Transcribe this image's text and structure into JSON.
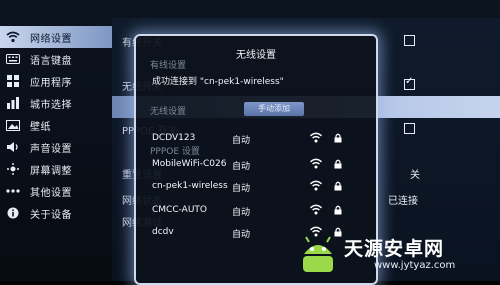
{
  "nav": {
    "items": [
      {
        "label": "网络设置",
        "icon": "wifi-icon",
        "selected": true
      },
      {
        "label": "语言键盘",
        "icon": "keyboard-icon",
        "selected": false
      },
      {
        "label": "应用程序",
        "icon": "apps-grid-icon",
        "selected": false
      },
      {
        "label": "城市选择",
        "icon": "bar-chart-icon",
        "selected": false
      },
      {
        "label": "壁纸",
        "icon": "wallpaper-icon",
        "selected": false
      },
      {
        "label": "声音设置",
        "icon": "speaker-icon",
        "selected": false
      },
      {
        "label": "屏幕调整",
        "icon": "screen-adjust-icon",
        "selected": false
      },
      {
        "label": "其他设置",
        "icon": "more-dots-icon",
        "selected": false
      },
      {
        "label": "关于设备",
        "icon": "info-icon",
        "selected": false
      }
    ]
  },
  "panel": {
    "rows": [
      {
        "label": "有线开关",
        "value": "",
        "checkbox": "off"
      },
      {
        "label": "无线开关",
        "value": "",
        "checkbox": "on"
      },
      {
        "label": "",
        "value": "",
        "checkbox": "none"
      },
      {
        "label": "PPPOE 开关",
        "value": "",
        "checkbox": "off"
      },
      {
        "label": "",
        "value": "",
        "checkbox": "none"
      },
      {
        "label": "重置设置",
        "value": "关",
        "checkbox": "none"
      },
      {
        "label": "网络状态",
        "value": "已连接",
        "checkbox": "none"
      },
      {
        "label": "网络测试",
        "value": "",
        "checkbox": "none"
      }
    ]
  },
  "dialog": {
    "title": "无线设置",
    "wired_label": "有线设置",
    "status": "成功连接到 \"cn-pek1-wireless\"",
    "wireless_label": "无线设置",
    "add_button": "手动添加",
    "pppoe_label": "PPPOE 设置",
    "networks": [
      {
        "ssid": "DCDV123",
        "mode": "自动",
        "secured": true
      },
      {
        "ssid": "MobileWiFi-C026",
        "mode": "自动",
        "secured": true
      },
      {
        "ssid": "cn-pek1-wireless",
        "mode": "自动",
        "secured": true
      },
      {
        "ssid": "CMCC-AUTO",
        "mode": "自动",
        "secured": true
      },
      {
        "ssid": "dcdv",
        "mode": "自动",
        "secured": true
      }
    ]
  },
  "watermark": {
    "title": "天源安卓网",
    "url": "www.jytyaz.com"
  },
  "colors": {
    "highlight": "#a8bce0",
    "dialog_border": "#cfd9ec",
    "background": "#0a1220"
  }
}
